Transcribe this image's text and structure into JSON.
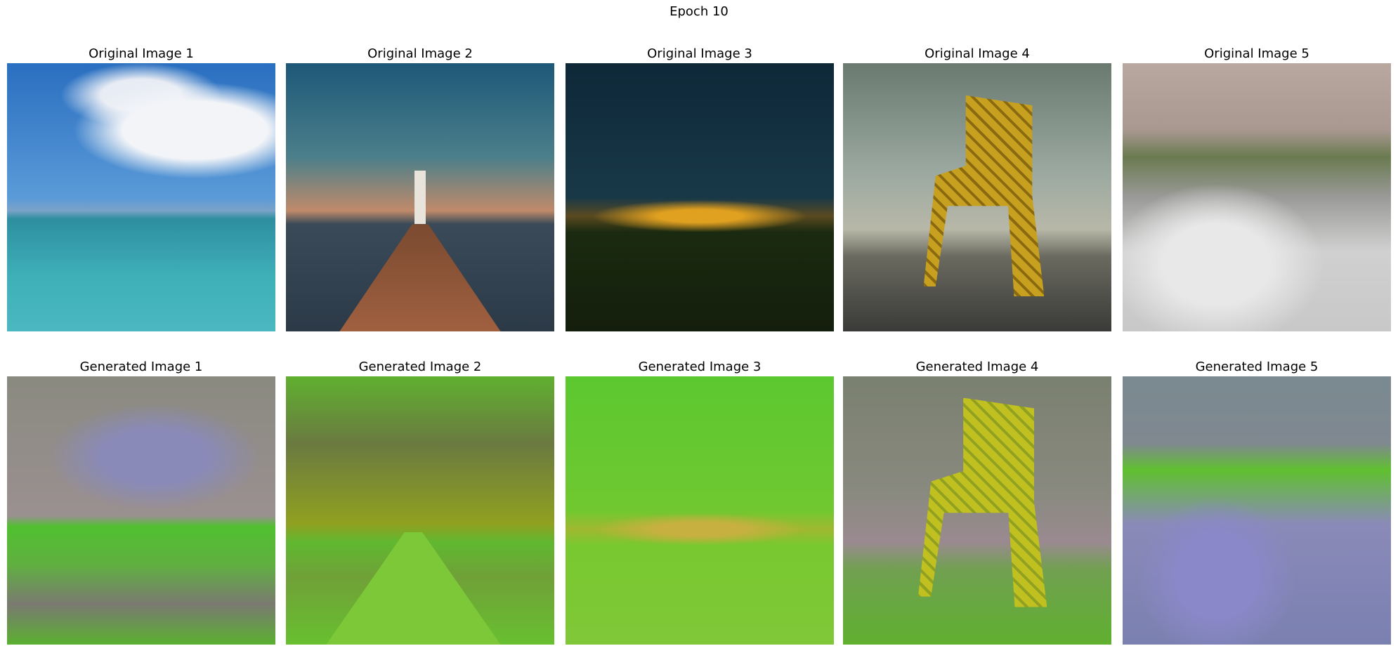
{
  "figure": {
    "title": "Epoch 10"
  },
  "original_titles": [
    "Original Image 1",
    "Original Image 2",
    "Original Image 3",
    "Original Image 4",
    "Original Image 5"
  ],
  "generated_titles": [
    "Generated Image 1",
    "Generated Image 2",
    "Generated Image 3",
    "Generated Image 4",
    "Generated Image 5"
  ]
}
